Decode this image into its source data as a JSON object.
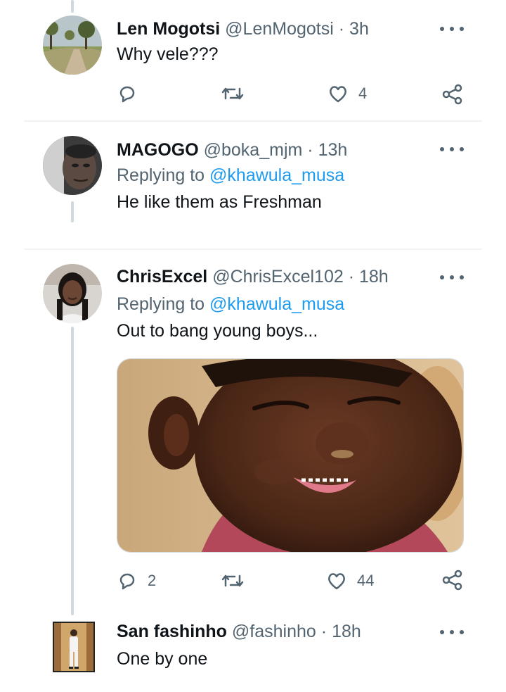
{
  "tweets": [
    {
      "name": "Len Mogotsi",
      "handle": "@LenMogotsi",
      "dot": "·",
      "time": "3h",
      "text": "Why vele???",
      "like_count": "4",
      "avatar_icon": "landscape-avatar"
    },
    {
      "name": "MAGOGO",
      "handle": "@boka_mjm",
      "dot": "·",
      "time": "13h",
      "replying_prefix": "Replying to",
      "replying_to": "@khawula_musa",
      "text": "He like them as Freshman",
      "avatar_icon": "man-portrait-avatar"
    },
    {
      "name": "ChrisExcel",
      "handle": "@ChrisExcel102",
      "dot": "·",
      "time": "18h",
      "replying_prefix": "Replying to",
      "replying_to": "@khawula_musa",
      "text": "Out to bang young boys...",
      "reply_count": "2",
      "like_count": "44",
      "media_icon": "laughing-child-photo",
      "avatar_icon": "woman-portrait-avatar"
    },
    {
      "name": "San fashinho",
      "handle": "@fashinho",
      "dot": "·",
      "time": "18h",
      "text": "One by one",
      "avatar_icon": "standing-man-avatar"
    }
  ],
  "colors": {
    "link": "#1d9bf0",
    "secondary_text": "#536471",
    "thread_line": "#cfd9de",
    "divider": "#eff3f4"
  }
}
